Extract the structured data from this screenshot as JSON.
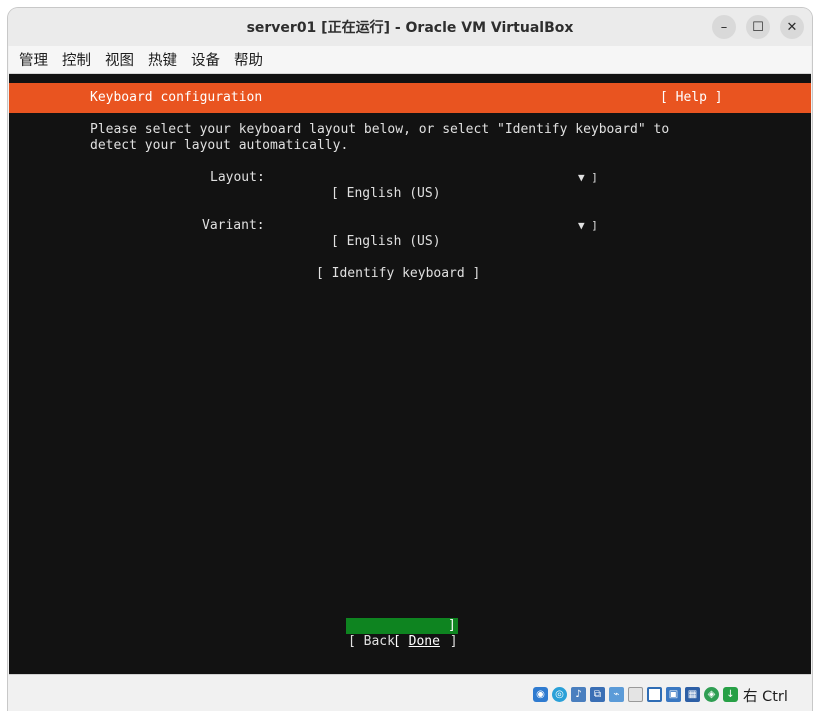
{
  "window": {
    "title": "server01 [正在运行] - Oracle VM VirtualBox",
    "controls": {
      "minimize": "–",
      "maximize": "☐",
      "close": "✕"
    }
  },
  "menubar": {
    "items": [
      {
        "label": "管理"
      },
      {
        "label": "控制"
      },
      {
        "label": "视图"
      },
      {
        "label": "热键"
      },
      {
        "label": "设备"
      },
      {
        "label": "帮助"
      }
    ]
  },
  "installer": {
    "header_title": "Keyboard configuration",
    "help_label": "[ Help ]",
    "intro_line1": "Please select your keyboard layout below, or select \"Identify keyboard\" to",
    "intro_line2": "detect your layout automatically.",
    "layout_label": "Layout:",
    "layout_value": "[ English (US)",
    "variant_label": "Variant:",
    "variant_value": "[ English (US)",
    "dropdown_arrow": "▼ ]",
    "identify_button": "[ Identify keyboard ]",
    "done_bracket_open": "[ ",
    "done_label": "Done",
    "done_bracket_close": "]",
    "back_label": "[ Back       ]",
    "colors": {
      "accent": "#e95420",
      "done_bg": "#0e8420",
      "screen_bg": "#121212"
    }
  },
  "statusbar": {
    "icons": [
      "hard-disk-icon",
      "optical-disc-icon",
      "audio-icon",
      "network-icon",
      "usb-icon",
      "shared-folder-icon",
      "display-icon",
      "recording-icon",
      "cpu-icon",
      "virtualization-icon",
      "mouse-integration-icon",
      "download-icon"
    ],
    "host_key": "右 Ctrl"
  }
}
